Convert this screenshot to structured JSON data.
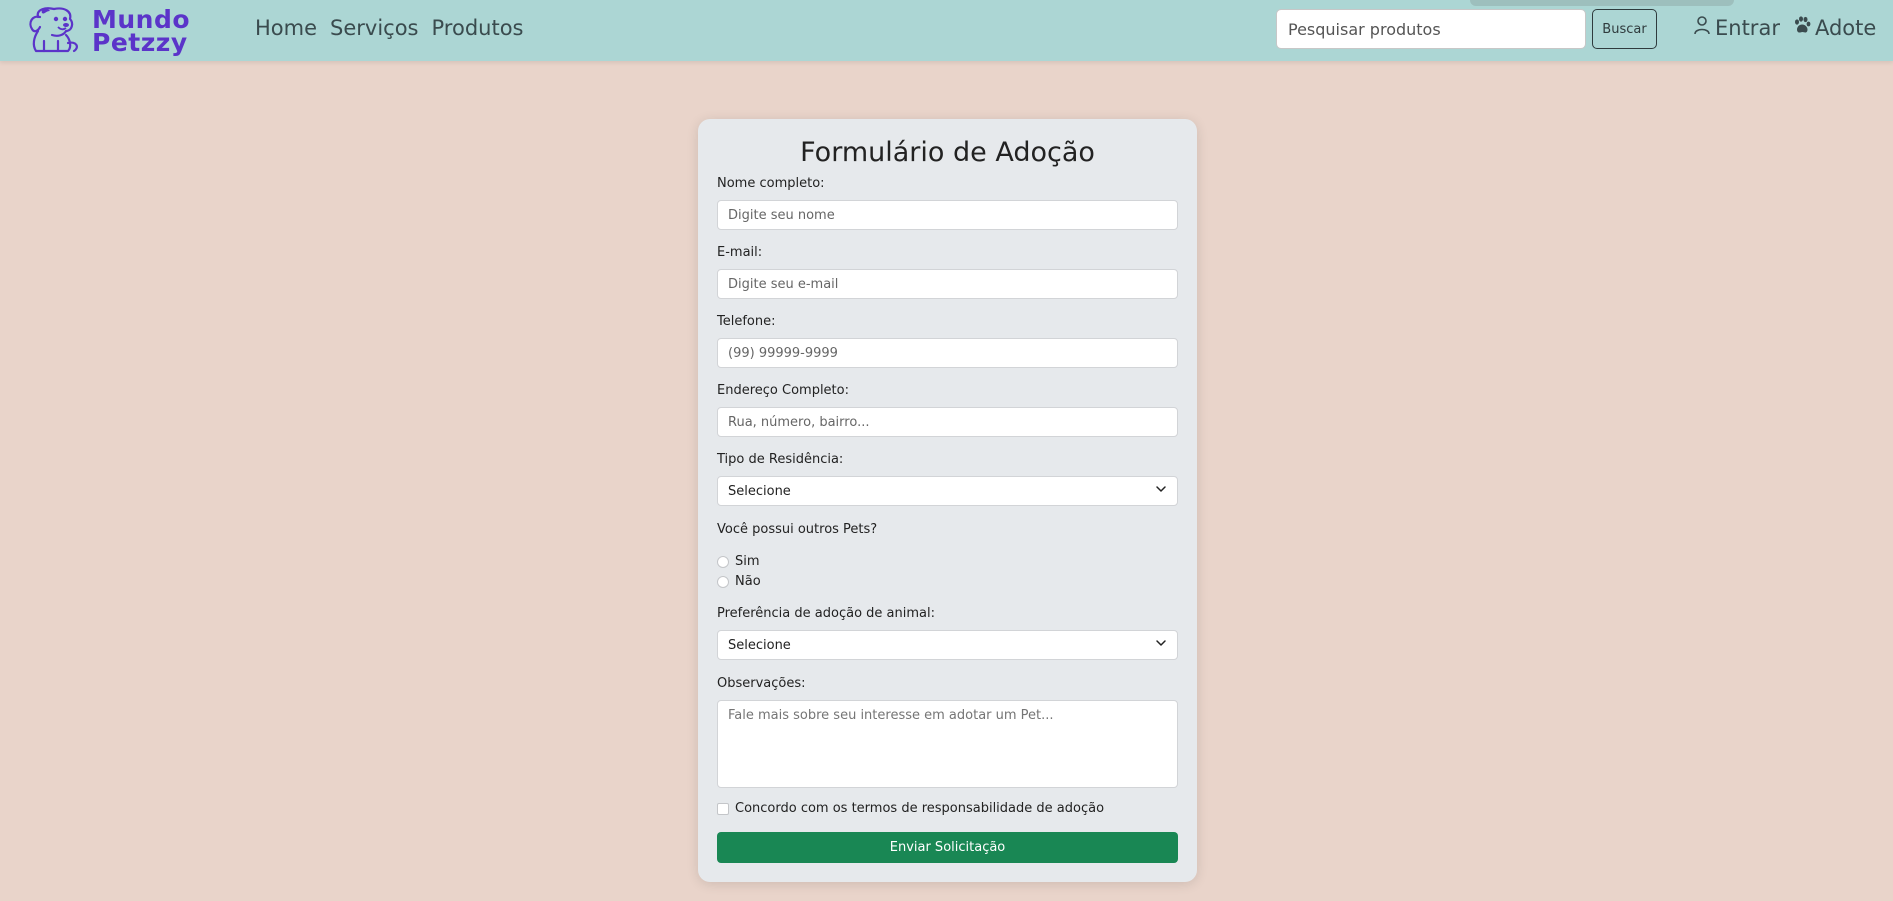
{
  "brand": {
    "name_line1": "Mundo",
    "name_line2": "Petzzy",
    "logo_icon": "dog-logo-icon",
    "color": "#5b34c9"
  },
  "nav": {
    "links": [
      "Home",
      "Serviços",
      "Produtos"
    ],
    "search_placeholder": "Pesquisar produtos",
    "search_button": "Buscar",
    "login_label": "Entrar",
    "login_icon": "user-icon",
    "adopt_label": "Adote",
    "adopt_icon": "paw-icon",
    "background": "#acd6d4"
  },
  "form": {
    "title": "Formulário de Adoção",
    "name_label": "Nome completo:",
    "name_placeholder": "Digite seu nome",
    "email_label": "E-mail:",
    "email_placeholder": "Digite seu e-mail",
    "phone_label": "Telefone:",
    "phone_placeholder": "(99) 99999-9999",
    "address_label": "Endereço Completo:",
    "address_placeholder": "Rua, número, bairro...",
    "residence_label": "Tipo de Residência:",
    "residence_selected": "Selecione",
    "pets_question": "Você possui outros Pets?",
    "pets_options": [
      "Sim",
      "Não"
    ],
    "preference_label": "Preferência de adoção de animal:",
    "preference_selected": "Selecione",
    "notes_label": "Observações:",
    "notes_placeholder": "Fale mais sobre seu interesse em adotar um Pet...",
    "terms_label": "Concordo com os termos de responsabilidade de adoção",
    "submit_label": "Enviar Solicitação",
    "submit_color": "#198754"
  },
  "page_background": "#e9d4ca"
}
